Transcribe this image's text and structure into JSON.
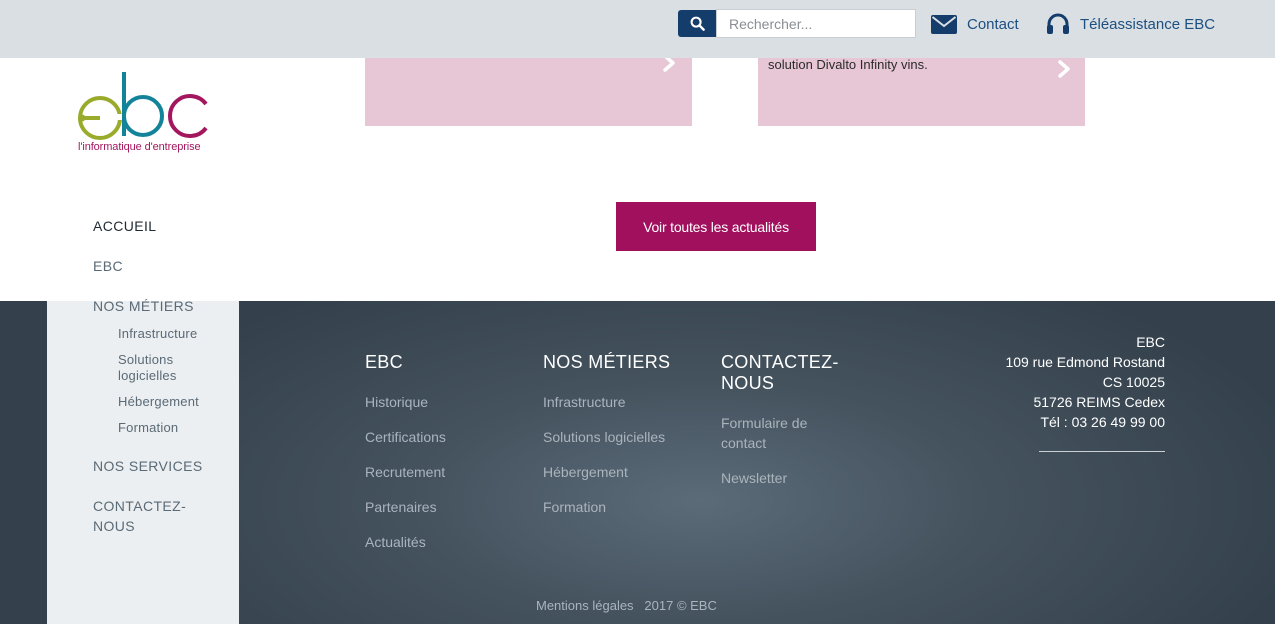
{
  "colors": {
    "brand_magenta": "#a0105d",
    "brand_navy": "#143d6b",
    "topbar_bg": "#d9dfe3",
    "card_pink": "#e7c6d5",
    "footer_dark": "#3a4752"
  },
  "topbar": {
    "search_placeholder": "Rechercher...",
    "search_icon": "search-icon",
    "contact_label": "Contact",
    "contact_icon": "envelope-icon",
    "teleassistance_label": "Téléassistance EBC",
    "teleassistance_icon": "headset-icon"
  },
  "news": {
    "card2_text": "solution Divalto Infinity vins."
  },
  "logo": {
    "wordmark": "ebc",
    "tagline": "l'informatique d'entreprise"
  },
  "cta": {
    "label": "Voir toutes les actualités"
  },
  "sidenav": {
    "items": [
      {
        "label": "ACCUEIL"
      },
      {
        "label": "EBC"
      },
      {
        "label": "NOS MÉTIERS"
      },
      {
        "label": "NOS SERVICES"
      },
      {
        "label": "CONTACTEZ-"
      },
      {
        "label": "NOUS"
      }
    ],
    "sub_items": [
      {
        "label": "Infrastructure"
      },
      {
        "label": "Solutions"
      },
      {
        "label": "logicielles"
      },
      {
        "label": "Hébergement"
      },
      {
        "label": "Formation"
      }
    ]
  },
  "footer": {
    "col_ebc": {
      "title": "EBC",
      "links": [
        "Historique",
        "Certifications",
        "Recrutement",
        "Partenaires",
        "Actualités"
      ]
    },
    "col_metiers": {
      "title": "NOS MÉTIERS",
      "links": [
        "Infrastructure",
        "Solutions logicielles",
        "Hébergement",
        "Formation"
      ]
    },
    "col_contact": {
      "title_line1": "CONTACTEZ-",
      "title_line2": "NOUS",
      "link1_line1": "Formulaire de",
      "link1_line2": "contact",
      "link2": "Newsletter"
    },
    "address": {
      "name": "EBC",
      "street": "109 rue Edmond Rostand",
      "cs": "CS 10025",
      "city": "51726 REIMS Cedex",
      "phone": "Tél : 03 26 49 99 00"
    },
    "legal_label": "Mentions légales",
    "copyright": "2017 © EBC"
  }
}
